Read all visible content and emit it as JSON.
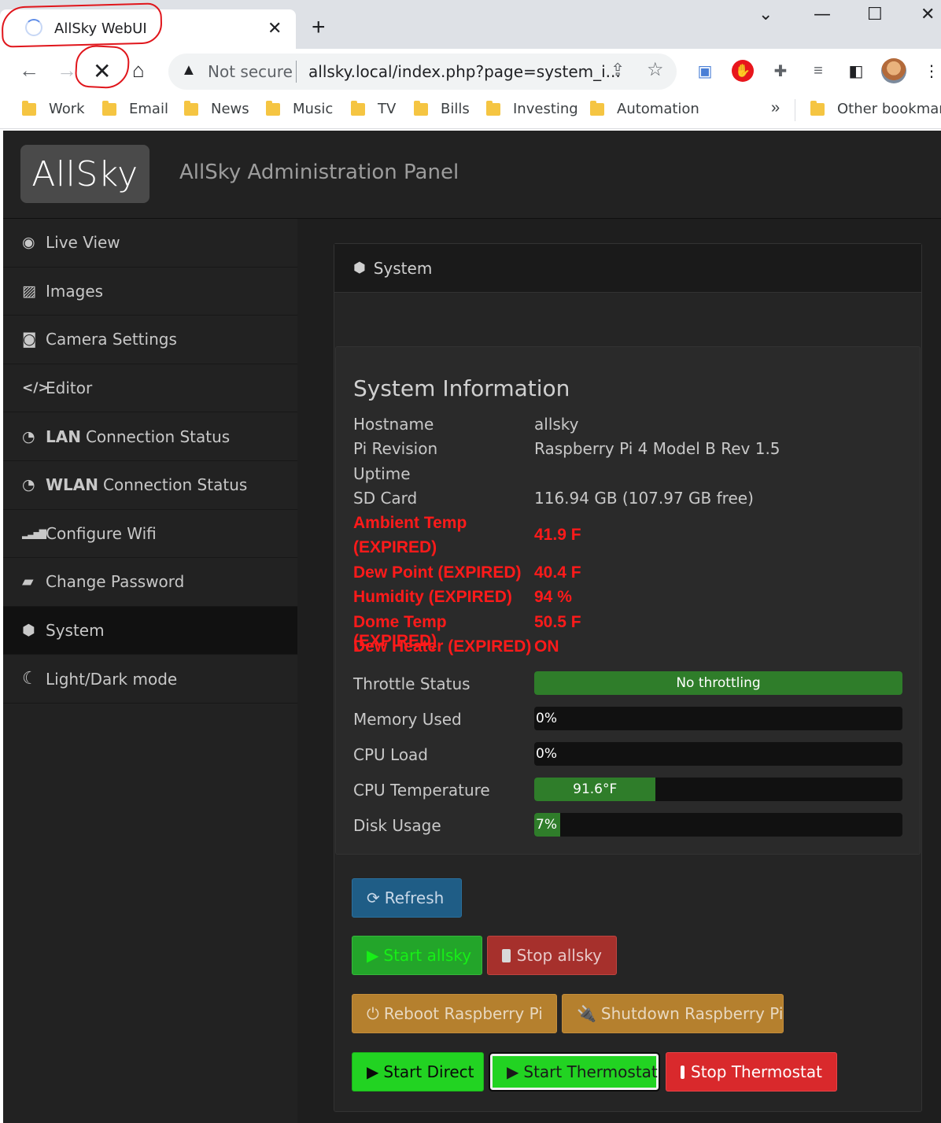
{
  "browser": {
    "tab_title": "AllSky WebUI",
    "tab_close": "✕",
    "new_tab": "+",
    "window": {
      "minimize": "—",
      "maximize": "☐",
      "close": "✕",
      "tabsearch": "⌄"
    },
    "security_label": "Not secure",
    "url": "allsky.local/index.php?page=system_i...",
    "bookmarks": [
      "Work",
      "Email",
      "News",
      "Music",
      "TV",
      "Bills",
      "Investing",
      "Automation"
    ],
    "bookmarks_more": "»",
    "other_bookmarks": "Other bookmarks"
  },
  "app": {
    "brand": "AllSky",
    "panel_title": "AllSky Administration Panel"
  },
  "sidebar": {
    "items": [
      {
        "label": "Live View",
        "icon": "eye-icon",
        "glyph": "👁"
      },
      {
        "label": "Images",
        "icon": "image-icon",
        "glyph": "🖼"
      },
      {
        "label": "Camera Settings",
        "icon": "camera-icon",
        "glyph": "📷"
      },
      {
        "label": "Editor",
        "icon": "code-icon",
        "glyph": "</>"
      },
      {
        "bold": "LAN",
        "label": "Connection Status",
        "icon": "dashboard-icon",
        "glyph": "◔"
      },
      {
        "bold": "WLAN",
        "label": "Connection Status",
        "icon": "dashboard-icon",
        "glyph": "◔"
      },
      {
        "label": "Configure Wifi",
        "icon": "signal-icon",
        "glyph": "▂▃▅▇"
      },
      {
        "label": "Change Password",
        "icon": "lock-icon",
        "glyph": "🔒"
      },
      {
        "label": "System",
        "icon": "cube-icon",
        "glyph": "⬢",
        "active": true
      },
      {
        "label": "Light/Dark mode",
        "icon": "moon-icon",
        "glyph": "☾"
      }
    ]
  },
  "system": {
    "header": "System",
    "title": "System Information",
    "rows": [
      {
        "key": "Hostname",
        "value": "allsky"
      },
      {
        "key": "Pi Revision",
        "value": "Raspberry Pi 4 Model B Rev 1.5"
      },
      {
        "key": "Uptime",
        "value": ""
      },
      {
        "key": "SD Card",
        "value": "116.94 GB (107.97 GB free)"
      }
    ],
    "sensor_rows": [
      {
        "key": "Ambient Temp",
        "key2": "(EXPIRED)",
        "value": "41.9 F"
      },
      {
        "key": "Dew Point (EXPIRED)",
        "value": "40.4 F"
      },
      {
        "key": "Humidity (EXPIRED)",
        "value": "94 %"
      },
      {
        "key": "Dome Temp (EXPIRED)",
        "value": "50.5 F"
      },
      {
        "key": "Dew Heater (EXPIRED)",
        "value": "ON"
      }
    ],
    "bars": [
      {
        "key": "Throttle Status",
        "label": "No throttling",
        "percent": 100
      },
      {
        "key": "Memory Used",
        "label": "0%",
        "percent": 0
      },
      {
        "key": "CPU Load",
        "label": "0%",
        "percent": 0
      },
      {
        "key": "CPU Temperature",
        "label": "91.6°F",
        "percent": 33
      },
      {
        "key": "Disk Usage",
        "label": "7%",
        "percent": 7
      }
    ],
    "bar_fill_color": "#2f7d2a"
  },
  "buttons": {
    "refresh": "Refresh",
    "start_allsky": "Start allsky",
    "stop_allsky": "Stop allsky",
    "reboot": "Reboot Raspberry Pi",
    "shutdown": "Shutdown Raspberry Pi",
    "start_direct": "Start Direct",
    "start_thermostat": "Start Thermostat",
    "stop_thermostat": "Stop Thermostat"
  },
  "colors": {
    "expired_red": "#ff1a1a",
    "annotation_red": "#e0161c"
  }
}
